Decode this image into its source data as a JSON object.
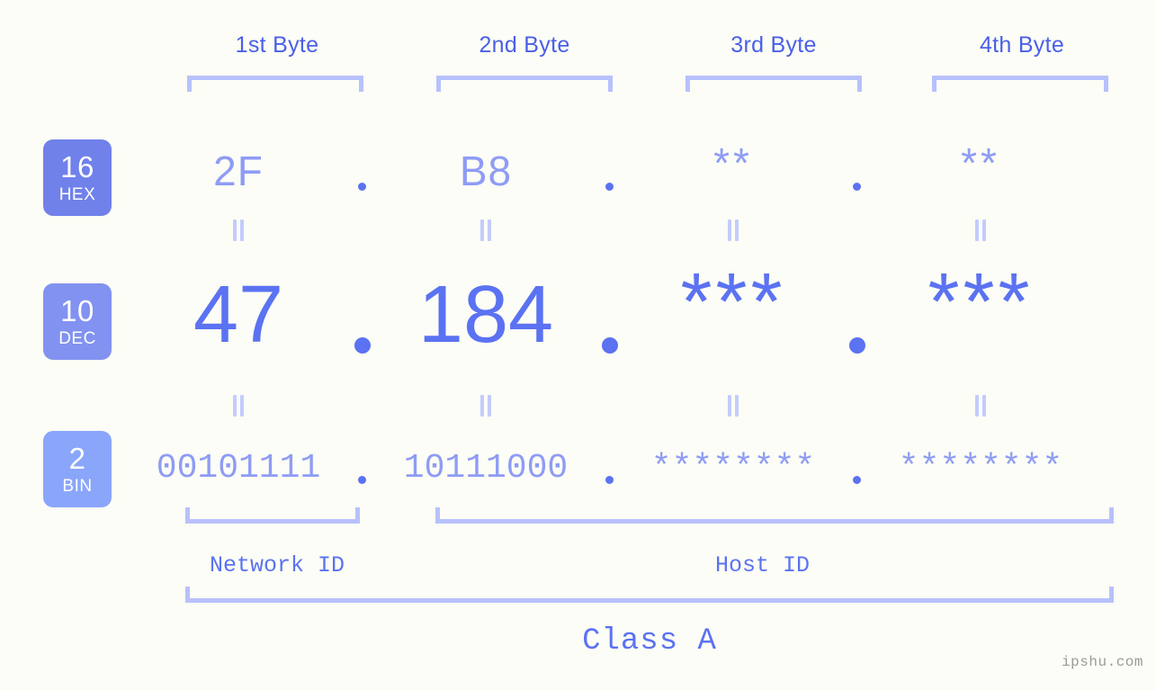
{
  "page": {
    "background_color": "#fcfdf6",
    "accent_strong": "#5b72f2",
    "accent_mid": "#8e9cf5",
    "accent_light": "#b7c1fd",
    "watermark": "ipshu.com"
  },
  "byte_headers": [
    {
      "label": "1st Byte"
    },
    {
      "label": "2nd Byte"
    },
    {
      "label": "3rd Byte"
    },
    {
      "label": "4th Byte"
    }
  ],
  "bases": [
    {
      "id": "hex",
      "number": "16",
      "abbr": "HEX",
      "color": "#7081ea"
    },
    {
      "id": "dec",
      "number": "10",
      "abbr": "DEC",
      "color": "#8292f0"
    },
    {
      "id": "bin",
      "number": "2",
      "abbr": "BIN",
      "color": "#8aa6fb"
    }
  ],
  "separator": ".",
  "rows": {
    "hex": {
      "values": [
        "2F",
        "B8",
        "**",
        "**"
      ]
    },
    "dec": {
      "values": [
        "47",
        "184",
        "***",
        "***"
      ]
    },
    "bin": {
      "values": [
        "00101111",
        "10111000",
        "********",
        "********"
      ]
    }
  },
  "segments": {
    "network_id": "Network ID",
    "host_id": "Host ID",
    "class": "Class A"
  }
}
